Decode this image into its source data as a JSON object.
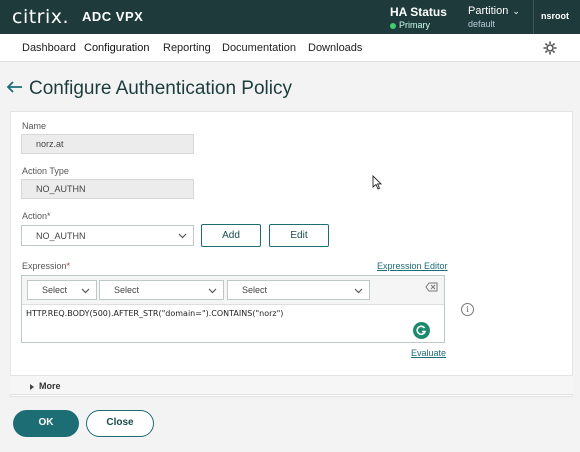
{
  "header": {
    "logo": "citrix.",
    "product": "ADC VPX",
    "ha_title": "HA Status",
    "ha_status": "Primary",
    "partition_title": "Partition",
    "partition_value": "default",
    "user": "nsroot"
  },
  "nav": {
    "items": [
      "Dashboard",
      "Configuration",
      "Reporting",
      "Documentation",
      "Downloads"
    ],
    "active": "Configuration"
  },
  "page": {
    "title": "Configure Authentication Policy"
  },
  "form": {
    "name_label": "Name",
    "name_value": "norz.at",
    "action_type_label": "Action Type",
    "action_type_value": "NO_AUTHN",
    "action_label": "Action*",
    "action_value": "NO_AUTHN",
    "add_label": "Add",
    "edit_label": "Edit",
    "expression_label": "Expression",
    "expression_editor_label": "Expression Editor",
    "select_1": "Select",
    "select_2": "Select",
    "select_3": "Select",
    "expression_value": "HTTP.REQ.BODY(500).AFTER_STR(\"domain=\").CONTAINS(\"norz\")",
    "evaluate_label": "Evaluate",
    "more_label": "More"
  },
  "footer": {
    "ok_label": "OK",
    "close_label": "Close"
  },
  "colors": {
    "header_bg": "#1e3a3a",
    "accent": "#1c6d74",
    "status_ok": "#3fd06d"
  }
}
